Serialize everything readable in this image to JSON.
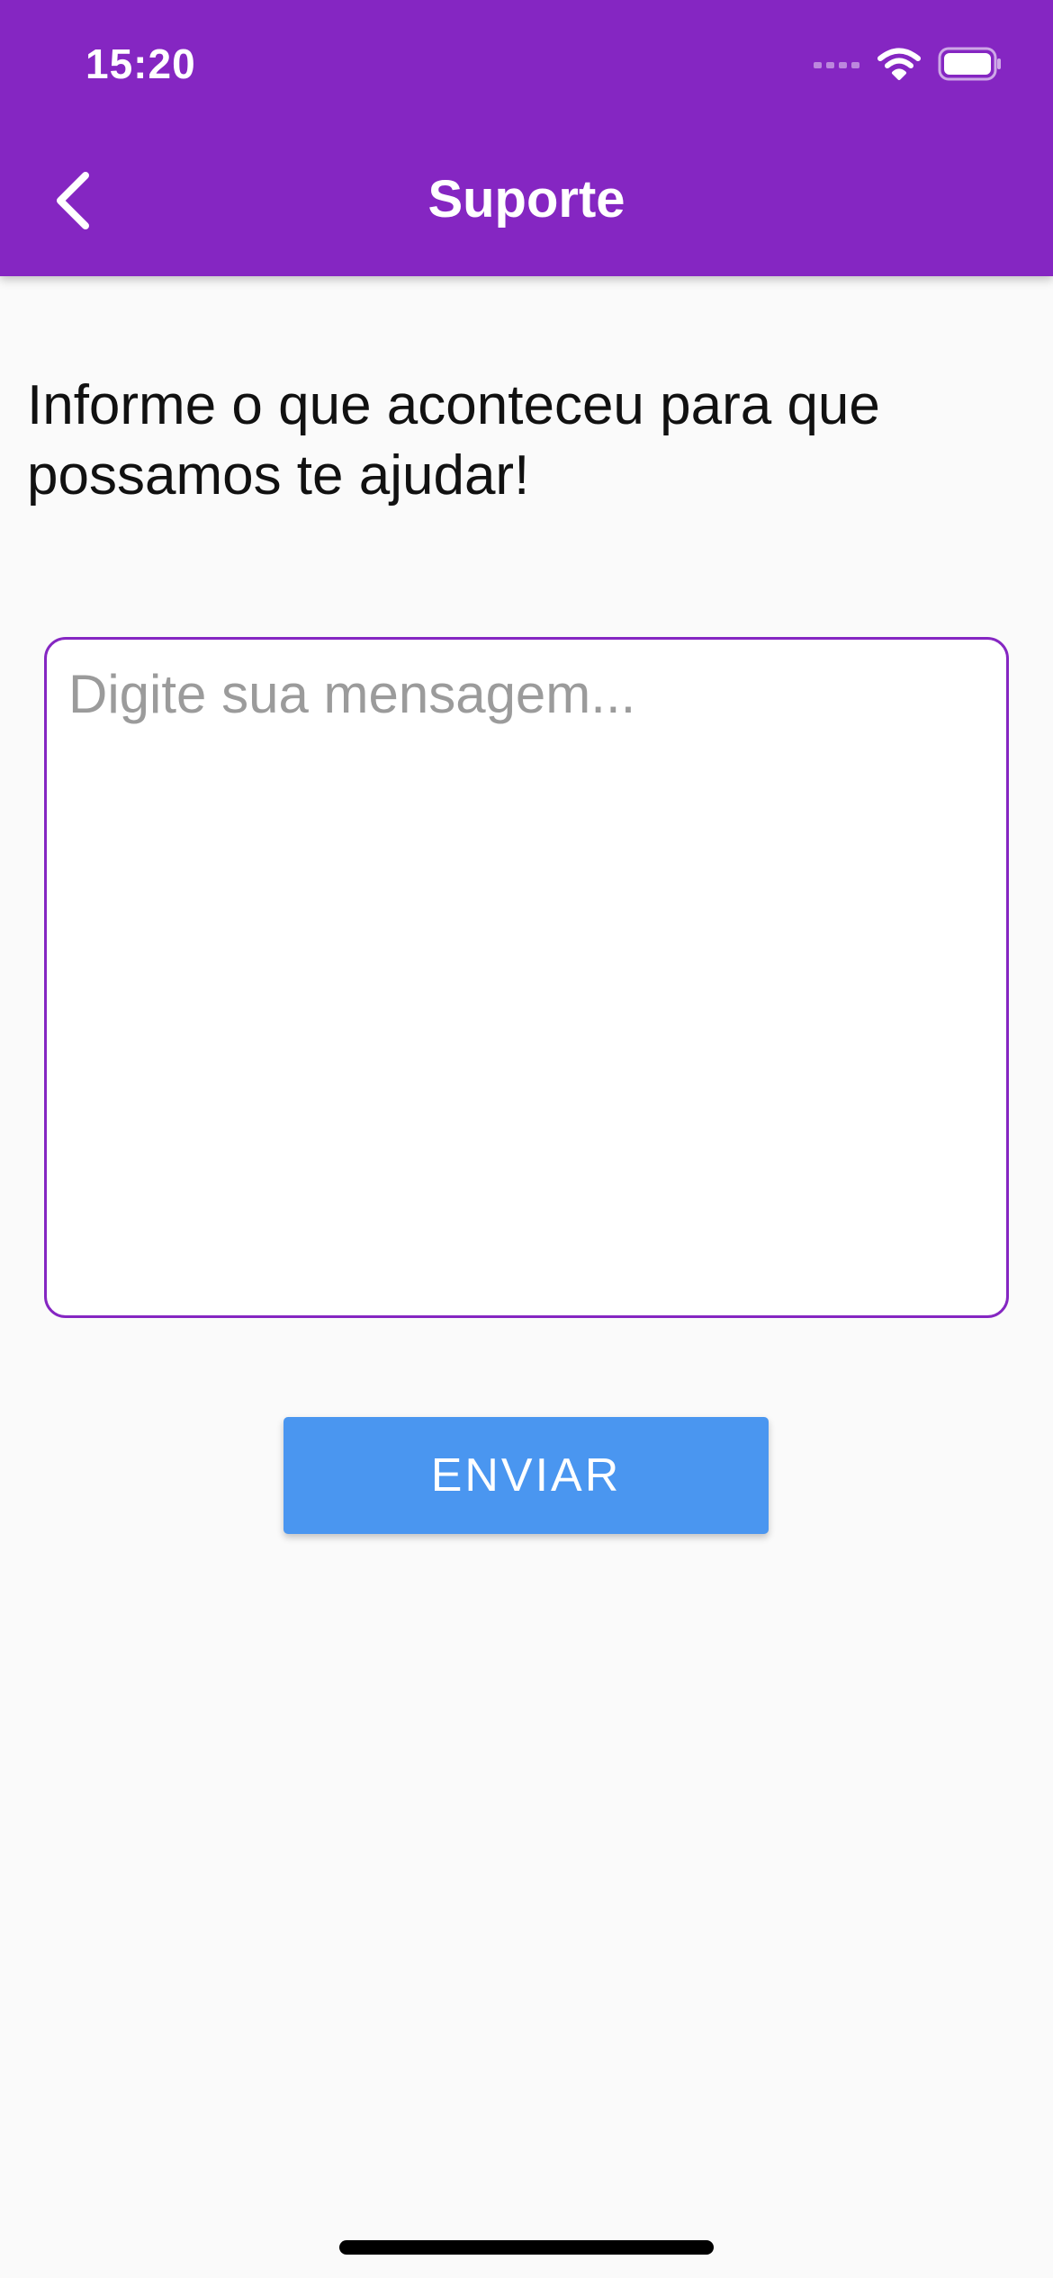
{
  "status_bar": {
    "time": "15:20",
    "icons": [
      "cellular-signal-icon",
      "wifi-icon",
      "battery-icon"
    ]
  },
  "app_bar": {
    "title": "Suporte",
    "back_icon": "chevron-left-icon"
  },
  "content": {
    "intro_text": "Informe o que aconteceu para que possamos te ajudar!",
    "message_input": {
      "value": "",
      "placeholder": "Digite sua mensagem..."
    },
    "send_button_label": "ENVIAR"
  },
  "colors": {
    "app_bar": "#8526c2",
    "input_border": "#8526c2",
    "send_button": "#4a96f0",
    "background": "#fafafa",
    "placeholder": "#9b9b9b"
  }
}
